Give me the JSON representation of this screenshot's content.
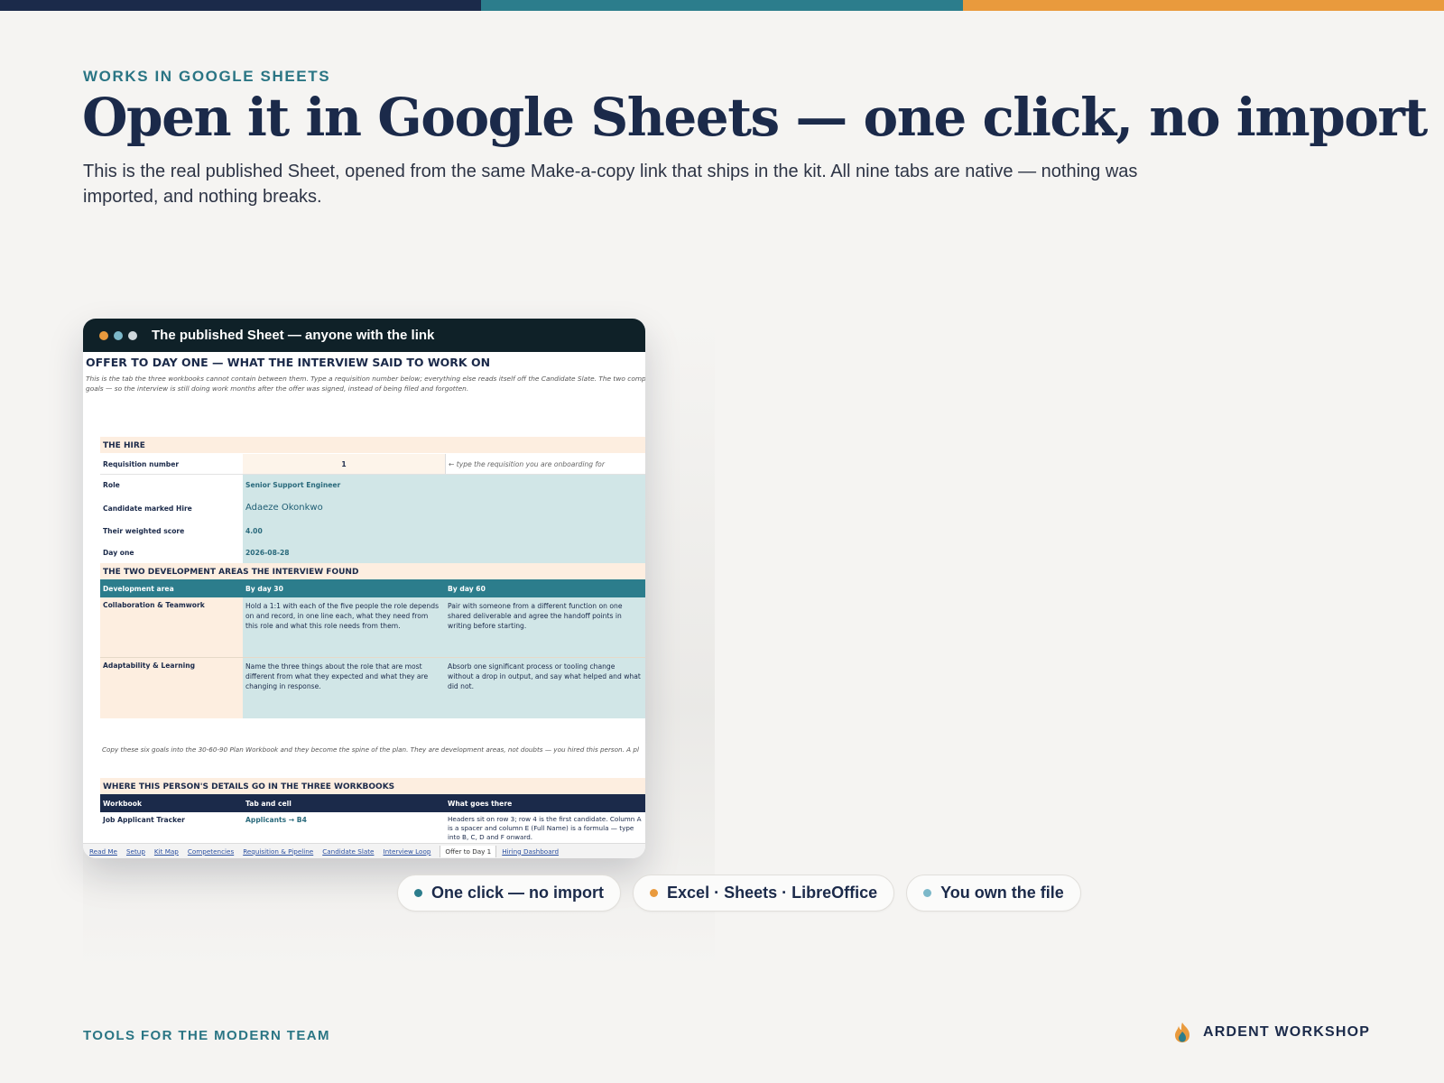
{
  "colors": {
    "navy": "#1b2a4a",
    "teal": "#2c7d8c",
    "orange": "#e99a3d",
    "lightblue": "#7cb8c9"
  },
  "eyebrow": "WORKS IN GOOGLE SHEETS",
  "headline": "Open it in Google Sheets — one click, no import",
  "lede": "This is the real published Sheet, opened from the same Make-a-copy link that ships in the kit. All nine tabs are native — nothing was imported, and nothing breaks.",
  "window": {
    "title": "The published Sheet — anyone with the link",
    "sheet": {
      "title": "OFFER TO DAY ONE — WHAT THE INTERVIEW SAID TO WORK ON",
      "intro": "This is the tab the three workbooks cannot contain between them. Type a requisition number below; everything else reads itself off the Candidate Slate. The two compete goals — so the interview is still doing work months after the offer was signed, instead of being filed and forgotten.",
      "hire_band": "THE HIRE",
      "hire_rows": [
        {
          "label": "Requisition number",
          "value": "1",
          "hint": "← type the requisition you are onboarding for"
        },
        {
          "label": "Role",
          "value": "Senior Support Engineer"
        },
        {
          "label": "Candidate marked Hire",
          "value": "Adaeze Okonkwo"
        },
        {
          "label": "Their weighted score",
          "value": "4.00"
        },
        {
          "label": "Day one",
          "value": "2026-08-28"
        }
      ],
      "dev_band": "THE TWO DEVELOPMENT AREAS THE INTERVIEW FOUND",
      "dev_headers": [
        "Development area",
        "By day 30",
        "By day 60"
      ],
      "dev_rows": [
        {
          "area": "Collaboration & Teamwork",
          "d30": "Hold a 1:1 with each of the five people the role depends on and record, in one line each, what they need from this role and what this role needs from them.",
          "d60": "Pair with someone from a different function on one shared deliverable and agree the handoff points in writing before starting."
        },
        {
          "area": "Adaptability & Learning",
          "d30": "Name the three things about the role that are most different from what they expected and what they are changing in response.",
          "d60": "Absorb one significant process or tooling change without a drop in output, and say what helped and what did not."
        }
      ],
      "note": "Copy these six goals into the 30-60-90 Plan Workbook and they become the spine of the plan. They are development areas, not doubts — you hired this person. A pl",
      "where_band": "WHERE THIS PERSON'S DETAILS GO IN THE THREE WORKBOOKS",
      "where_headers": [
        "Workbook",
        "Tab and cell",
        "What goes there"
      ],
      "where_rows": [
        {
          "workbook": "Job Applicant Tracker",
          "cell": "Applicants → B4",
          "what": "Headers sit on row 3; row 4 is the first candidate. Column A is a spacer and column E (Full Name) is a formula — type into B, C, D and F onward."
        }
      ],
      "tabs": [
        "Read Me",
        "Setup",
        "Kit Map",
        "Competencies",
        "Requisition & Pipeline",
        "Candidate Slate",
        "Interview Loop",
        "Offer to Day 1",
        "Hiring Dashboard"
      ],
      "active_tab": "Offer to Day 1"
    }
  },
  "pills": [
    {
      "label": "One click — no import",
      "dot_color": "#2c7d8c"
    },
    {
      "label": "Excel · Sheets · LibreOffice",
      "dot_color": "#e99a3d"
    },
    {
      "label": "You own the file",
      "dot_color": "#7cb8c9"
    }
  ],
  "footer": {
    "tagline": "TOOLS FOR THE MODERN TEAM",
    "brand": "ARDENT WORKSHOP"
  }
}
